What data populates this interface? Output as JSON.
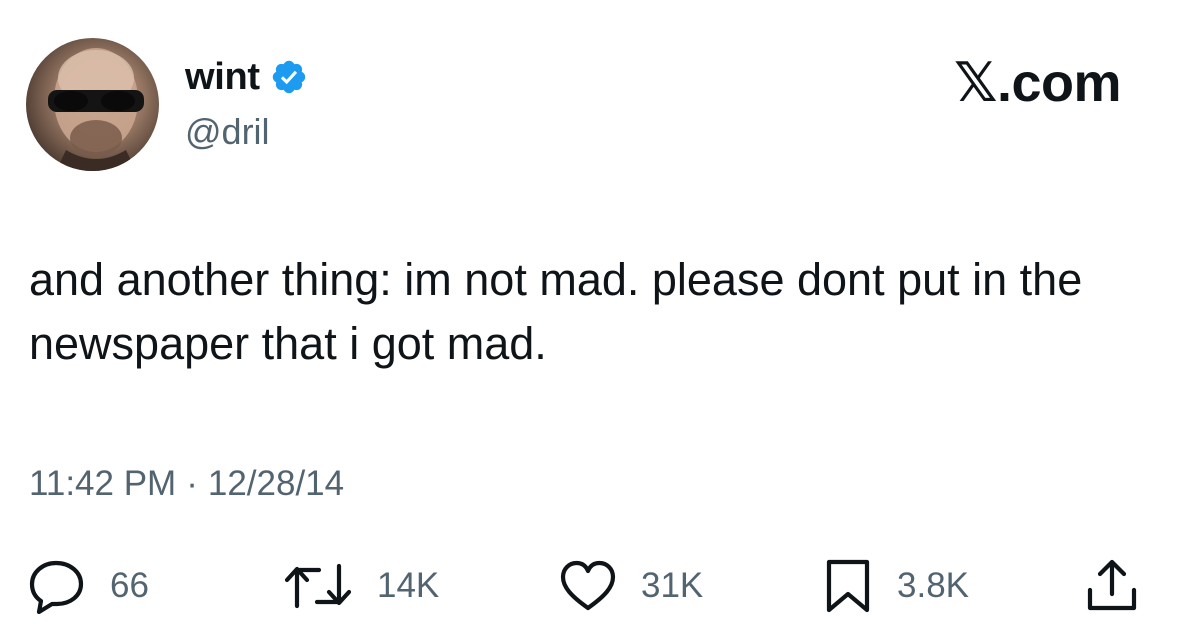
{
  "user": {
    "display_name": "wint",
    "handle": "@dril",
    "verified": true
  },
  "brand": "𝕏.com",
  "tweet": {
    "text": "and another thing: im not mad. please dont put in the newspaper that i got mad.",
    "time": "11:42 PM",
    "separator": "·",
    "date": "12/28/14"
  },
  "actions": {
    "replies": "66",
    "retweets": "14K",
    "likes": "31K",
    "bookmarks": "3.8K"
  },
  "icons": {
    "verified": "verified-badge-icon",
    "reply": "speech-bubble-icon",
    "retweet": "retweet-arrows-icon",
    "like": "heart-icon",
    "bookmark": "bookmark-icon",
    "share": "share-upload-icon"
  },
  "colors": {
    "verified": "#1d9bf0",
    "text": "#0f1419",
    "muted": "#536471",
    "background": "#ffffff"
  }
}
